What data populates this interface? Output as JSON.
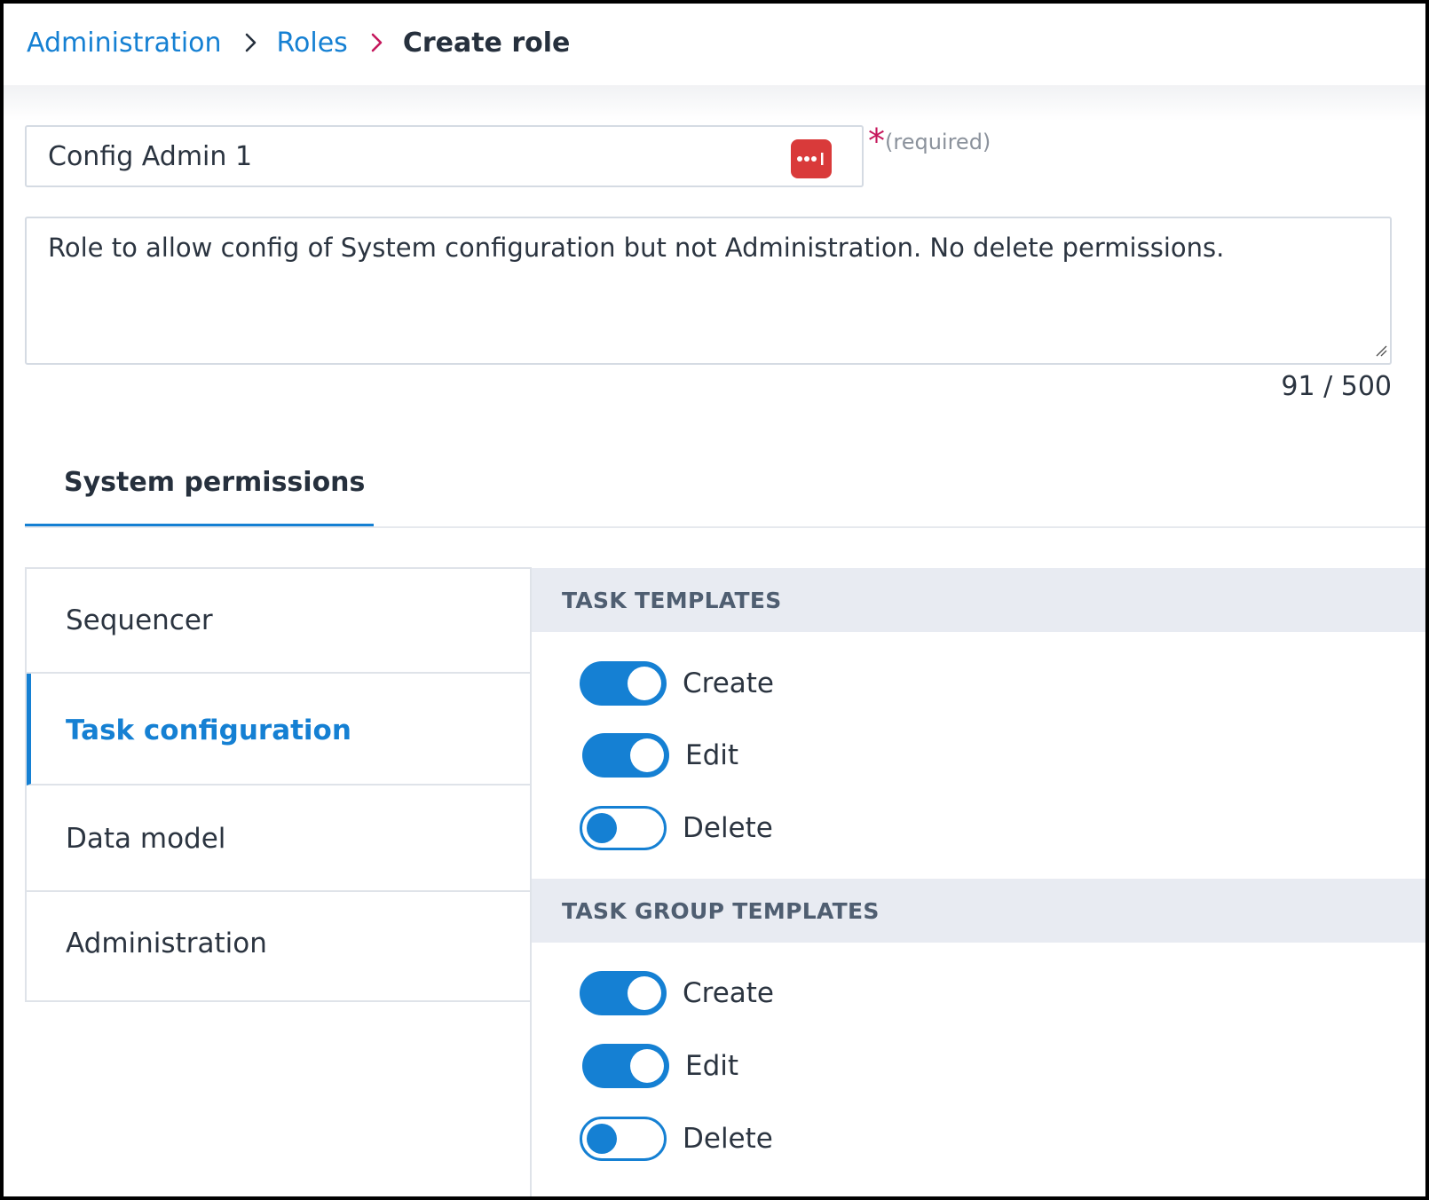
{
  "breadcrumb": {
    "items": [
      "Administration",
      "Roles"
    ],
    "current": "Create role"
  },
  "colors": {
    "accent": "#1580d3",
    "required_star": "#c5175c",
    "password_manager_icon": "#d93a3a"
  },
  "form": {
    "name_value": "Config Admin 1",
    "required_star": "*",
    "required_text": "(required)",
    "description_value": "Role to allow config of System configuration but not Administration. No delete permissions.",
    "char_count": "91 / 500"
  },
  "tabs": [
    {
      "label": "System permissions",
      "active": true
    }
  ],
  "categories": [
    {
      "label": "Sequencer",
      "active": false
    },
    {
      "label": "Task configuration",
      "active": true
    },
    {
      "label": "Data model",
      "active": false
    },
    {
      "label": "Administration",
      "active": false
    }
  ],
  "sections": [
    {
      "title": "TASK TEMPLATES",
      "permissions": [
        {
          "label": "Create",
          "enabled": true
        },
        {
          "label": "Edit",
          "enabled": true
        },
        {
          "label": "Delete",
          "enabled": false
        }
      ]
    },
    {
      "title": "TASK GROUP TEMPLATES",
      "permissions": [
        {
          "label": "Create",
          "enabled": true
        },
        {
          "label": "Edit",
          "enabled": true
        },
        {
          "label": "Delete",
          "enabled": false
        }
      ]
    }
  ]
}
